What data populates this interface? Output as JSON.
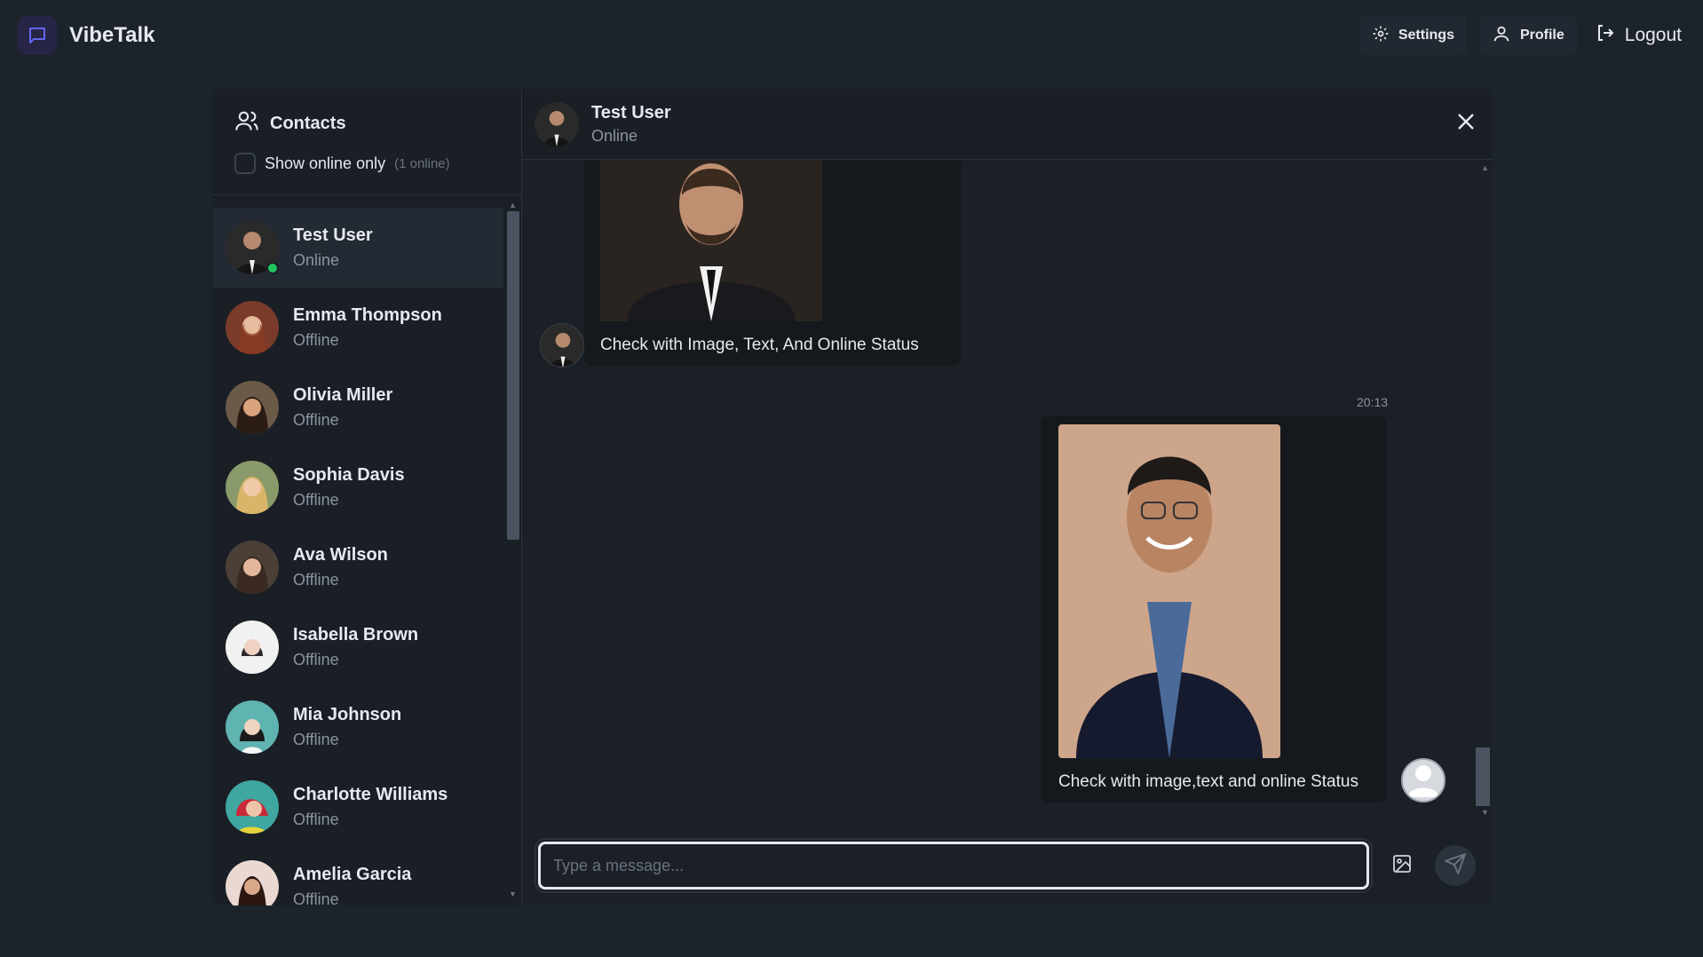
{
  "app": {
    "name": "VibeTalk"
  },
  "nav": {
    "settings_label": "Settings",
    "profile_label": "Profile",
    "logout_label": "Logout"
  },
  "sidebar": {
    "title": "Contacts",
    "filter_label": "Show online only",
    "online_count": "(1 online)",
    "contacts": [
      {
        "name": "Test User",
        "status": "Online"
      },
      {
        "name": "Emma Thompson",
        "status": "Offline"
      },
      {
        "name": "Olivia Miller",
        "status": "Offline"
      },
      {
        "name": "Sophia Davis",
        "status": "Offline"
      },
      {
        "name": "Ava Wilson",
        "status": "Offline"
      },
      {
        "name": "Isabella Brown",
        "status": "Offline"
      },
      {
        "name": "Mia Johnson",
        "status": "Offline"
      },
      {
        "name": "Charlotte Williams",
        "status": "Offline"
      },
      {
        "name": "Amelia Garcia",
        "status": "Offline"
      }
    ]
  },
  "chat": {
    "header": {
      "name": "Test User",
      "status": "Online"
    },
    "messages": [
      {
        "direction": "incoming",
        "text": "Check with Image, Text, And Online Status",
        "time": ""
      },
      {
        "direction": "outgoing",
        "text": "Check with image,text and online Status",
        "time": "20:13"
      }
    ],
    "composer": {
      "placeholder": "Type a message..."
    }
  },
  "colors": {
    "background": "#1d232a",
    "panel": "#191e24",
    "accent": "#6366f1",
    "online": "#22c55e"
  }
}
